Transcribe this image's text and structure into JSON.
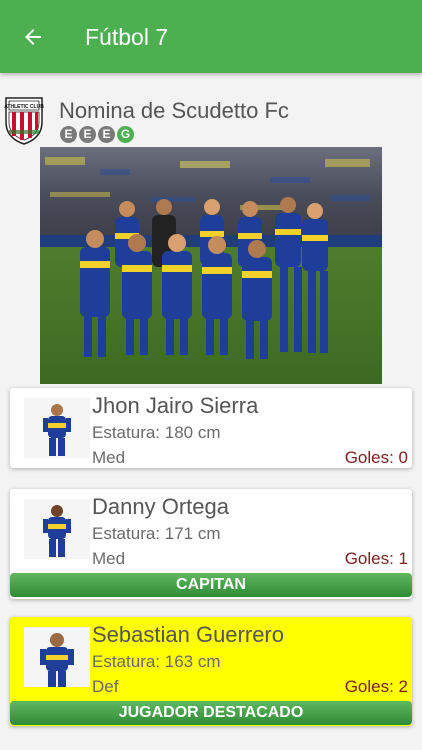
{
  "appbar": {
    "title": "Fútbol 7",
    "back_icon": "arrow-left-icon",
    "color": "#4caf50"
  },
  "team": {
    "name": "Nomina de Scudetto Fc",
    "crest_icon": "athletic-club-crest",
    "crest_text": "ATHLETIC CLUB",
    "form": [
      "E",
      "E",
      "E",
      "G"
    ]
  },
  "players": [
    {
      "name": "Jhon Jairo Sierra",
      "height": "Estatura: 180 cm",
      "position": "Med",
      "goals": "Goles: 0",
      "banner": ""
    },
    {
      "name": "Danny Ortega",
      "height": "Estatura: 171 cm",
      "position": "Med",
      "goals": "Goles: 1",
      "banner": "CAPITAN"
    },
    {
      "name": "Sebastian Guerrero",
      "height": "Estatura: 163 cm",
      "position": "Def",
      "goals": "Goles: 2",
      "banner": "JUGADOR DESTACADO"
    }
  ],
  "colors": {
    "highlight": "#ffff00",
    "goals_text": "#7b1f1f",
    "banner_green": "#3a9a3f"
  }
}
